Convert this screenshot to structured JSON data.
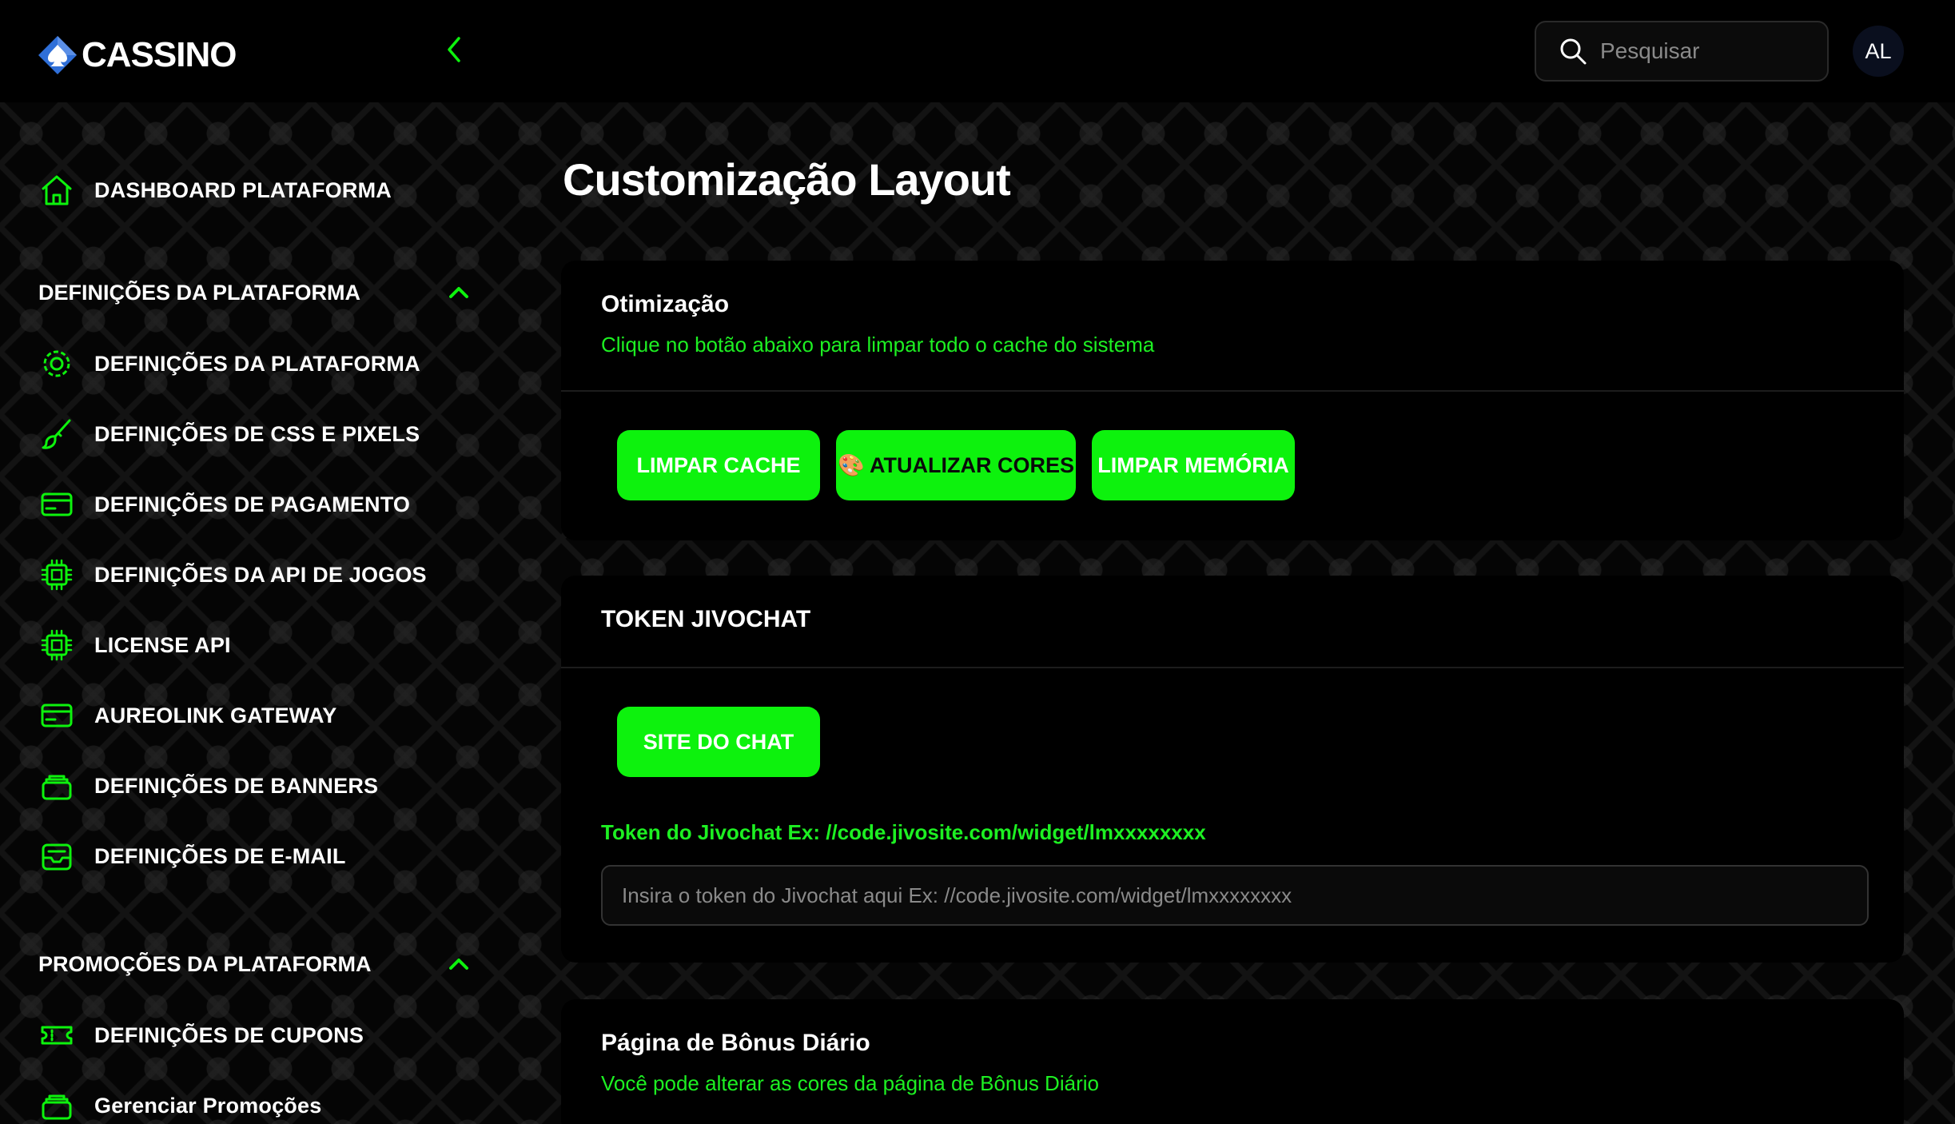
{
  "header": {
    "logo_text": "CASSINO",
    "search_placeholder": "Pesquisar",
    "avatar_initials": "AL"
  },
  "colors": {
    "accent": "#0df20d",
    "accent_text": "#1df022",
    "background": "#000000",
    "card": "#000000"
  },
  "sidebar": {
    "dashboard_label": "DASHBOARD PLATAFORMA",
    "section1_title": "DEFINIÇÕES DA PLATAFORMA",
    "section1_items": [
      {
        "label": "DEFINIÇÕES DA PLATAFORMA",
        "icon": "gear-icon"
      },
      {
        "label": "DEFINIÇÕES DE CSS E PIXELS",
        "icon": "brush-icon"
      },
      {
        "label": "DEFINIÇÕES DE PAGAMENTO",
        "icon": "credit-card-icon"
      },
      {
        "label": "DEFINIÇÕES DA API DE JOGOS",
        "icon": "chip-icon"
      },
      {
        "label": "LICENSE API",
        "icon": "chip-icon"
      },
      {
        "label": "AUREOLINK GATEWAY",
        "icon": "credit-card-icon"
      },
      {
        "label": "DEFINIÇÕES DE BANNERS",
        "icon": "stack-icon"
      },
      {
        "label": "DEFINIÇÕES DE E-MAIL",
        "icon": "inbox-icon"
      }
    ],
    "section2_title": "PROMOÇÕES DA PLATAFORMA",
    "section2_items": [
      {
        "label": "DEFINIÇÕES DE CUPONS",
        "icon": "ticket-icon"
      },
      {
        "label": "Gerenciar Promoções",
        "icon": "stack-icon"
      }
    ]
  },
  "main": {
    "page_title": "Customização Layout",
    "optimization": {
      "title": "Otimização",
      "subtitle": "Clique no botão abaixo para limpar todo o cache do sistema",
      "buttons": [
        "LIMPAR CACHE",
        "🎨 ATUALIZAR CORES",
        "LIMPAR MEMÓRIA"
      ]
    },
    "jivochat": {
      "title": "TOKEN JIVOCHAT",
      "site_button": "SITE DO CHAT",
      "field_label": "Token do Jivochat Ex: //code.jivosite.com/widget/lmxxxxxxxx",
      "field_placeholder": "Insira o token do Jivochat aqui Ex: //code.jivosite.com/widget/lmxxxxxxxx",
      "field_value": ""
    },
    "bonus": {
      "title": "Página de Bônus Diário",
      "subtitle": "Você pode alterar as cores da página de Bônus Diário"
    }
  }
}
